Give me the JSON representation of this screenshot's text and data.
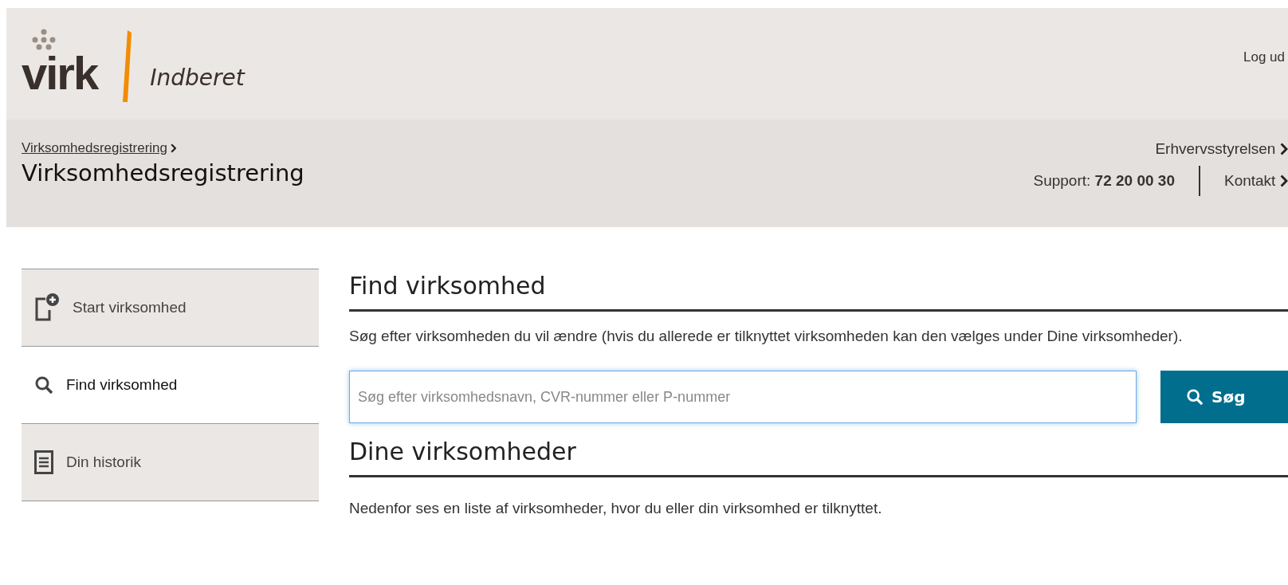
{
  "header": {
    "logo_text": "virk",
    "service": "Indberet",
    "logout": "Log ud"
  },
  "subheader": {
    "breadcrumb": "Virksomhedsregistrering",
    "title": "Virksomhedsregistrering",
    "agency": "Erhvervsstyrelsen",
    "support_label": "Support:",
    "support_phone": "72 20 00 30",
    "contact": "Kontakt"
  },
  "sidebar": {
    "items": [
      {
        "kind": "start",
        "label": "Start virksomhed",
        "selected": false
      },
      {
        "kind": "find",
        "label": "Find virksomhed",
        "selected": true
      },
      {
        "kind": "history",
        "label": "Din historik",
        "selected": false
      }
    ]
  },
  "find": {
    "heading": "Find virksomhed",
    "intro": "Søg efter virksomheden du vil ændre (hvis du allerede er tilknyttet virksomheden kan den vælges under Dine virksomheder).",
    "search": {
      "placeholder": "Søg efter virksomhedsnavn, CVR-nummer eller P-nummer"
    },
    "button": "Søg"
  },
  "mine": {
    "heading": "Dine virksomheder",
    "intro": "Nedenfor ses en liste af virksomheder, hvor du eller din virksomhed er tilknyttet."
  }
}
